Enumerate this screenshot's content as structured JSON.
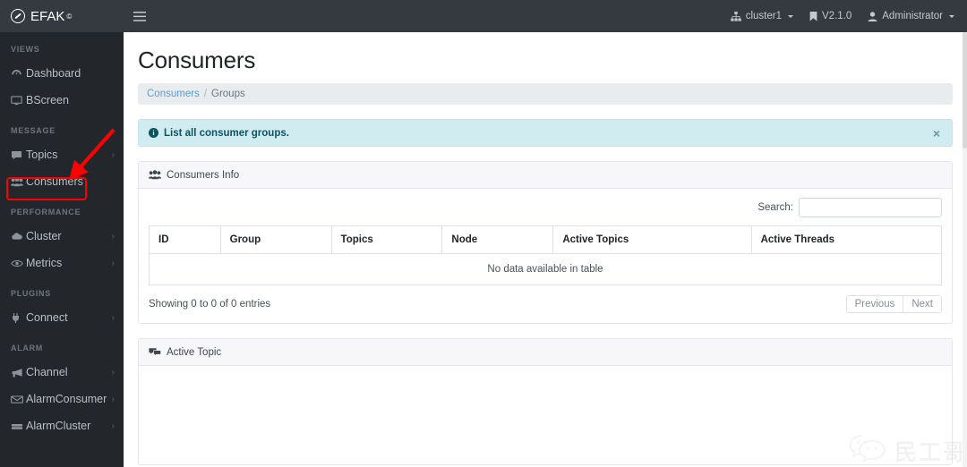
{
  "topbar": {
    "brand": "EFAK",
    "brand_sup": "©",
    "brand_logo_icon": "efak-circle-logo",
    "hamburger_icon": "hamburger-menu-icon",
    "cluster": {
      "label": "cluster1",
      "icon": "sitemap-icon"
    },
    "version": {
      "label": "V2.1.0",
      "icon": "bookmark-icon"
    },
    "user": {
      "label": "Administrator",
      "icon": "user-icon"
    }
  },
  "sidebar": {
    "sections": [
      {
        "title": "VIEWS",
        "items": [
          {
            "label": "Dashboard",
            "icon": "tachometer-icon",
            "arrow": false
          },
          {
            "label": "BScreen",
            "icon": "desktop-icon",
            "arrow": false
          }
        ]
      },
      {
        "title": "MESSAGE",
        "items": [
          {
            "label": "Topics",
            "icon": "comment-icon",
            "arrow": true
          },
          {
            "label": "Consumers",
            "icon": "users-icon",
            "arrow": false
          }
        ]
      },
      {
        "title": "PERFORMANCE",
        "items": [
          {
            "label": "Cluster",
            "icon": "cloud-icon",
            "arrow": true
          },
          {
            "label": "Metrics",
            "icon": "eye-icon",
            "arrow": true
          }
        ]
      },
      {
        "title": "PLUGINS",
        "items": [
          {
            "label": "Connect",
            "icon": "plug-icon",
            "arrow": true
          }
        ]
      },
      {
        "title": "ALARM",
        "items": [
          {
            "label": "Channel",
            "icon": "bullhorn-icon",
            "arrow": true
          },
          {
            "label": "AlarmConsumer",
            "icon": "envelope-icon",
            "arrow": true
          },
          {
            "label": "AlarmCluster",
            "icon": "server-icon",
            "arrow": true
          }
        ]
      }
    ]
  },
  "page": {
    "title": "Consumers",
    "breadcrumb": {
      "link": "Consumers",
      "separator": "/",
      "current": "Groups"
    },
    "alert": {
      "icon": "info-circle-icon",
      "glyph": "i",
      "text": "List all consumer groups.",
      "close": "×"
    }
  },
  "consumers_card": {
    "icon": "users-icon",
    "title": "Consumers Info",
    "search_label": "Search:",
    "search_value": "",
    "search_placeholder": "",
    "columns": [
      "ID",
      "Group",
      "Topics",
      "Node",
      "Active Topics",
      "Active Threads"
    ],
    "rows": [],
    "empty_text": "No data available in table",
    "info_text": "Showing 0 to 0 of 0 entries",
    "pager": {
      "previous": "Previous",
      "next": "Next"
    }
  },
  "active_topic_card": {
    "icon": "comments-icon",
    "title": "Active Topic"
  },
  "watermark": {
    "text": "民工哥技术之路",
    "icon": "wechat-icon"
  },
  "annotations": {
    "highlight_color": "#ff0000",
    "highlight_target": "Consumers",
    "arrow_color": "#ff0000"
  },
  "colors": {
    "topbar_bg": "#343a40",
    "sidebar_bg": "#23272b",
    "alert_bg": "#d1ecf1",
    "alert_fg": "#0c5460",
    "link": "#5b9dd9"
  }
}
